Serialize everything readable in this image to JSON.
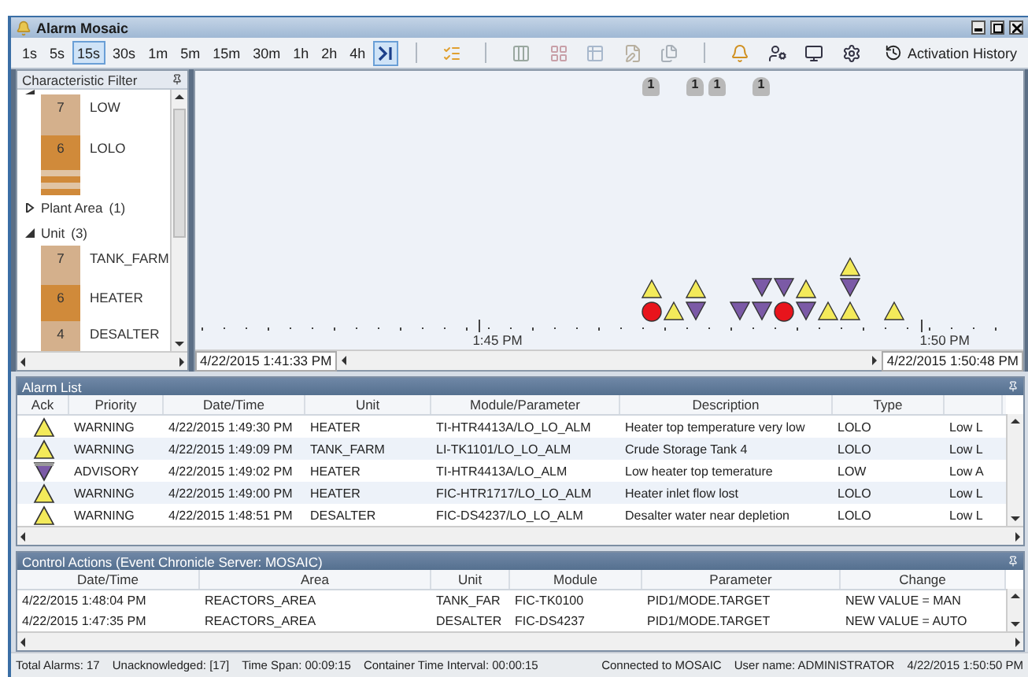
{
  "window": {
    "title": "Alarm Mosaic"
  },
  "toolbar": {
    "time_spans": [
      {
        "label": "1s",
        "selected": false
      },
      {
        "label": "5s",
        "selected": false
      },
      {
        "label": "15s",
        "selected": true
      },
      {
        "label": "30s",
        "selected": false
      },
      {
        "label": "1m",
        "selected": false
      },
      {
        "label": "5m",
        "selected": false
      },
      {
        "label": "15m",
        "selected": false
      },
      {
        "label": "30m",
        "selected": false
      },
      {
        "label": "1h",
        "selected": false
      },
      {
        "label": "2h",
        "selected": false
      },
      {
        "label": "4h",
        "selected": false
      }
    ],
    "live_mode": true,
    "history_button": "Activation History"
  },
  "filter": {
    "title": "Characteristic Filter",
    "groups": [
      {
        "expanded": true,
        "items": [
          {
            "count": "7",
            "label": "LOW",
            "color": "#d4b08c"
          },
          {
            "count": "6",
            "label": "LOLO",
            "color": "#d08a3a"
          },
          {
            "color": "#e0c4a4"
          },
          {
            "color": "#d08a3a"
          },
          {
            "color": "#e0c4a4"
          },
          {
            "color": "#d08a3a"
          }
        ]
      },
      {
        "label": "Plant Area",
        "count": "(1)",
        "expanded": false
      },
      {
        "label": "Unit",
        "count": "(3)",
        "expanded": true,
        "items": [
          {
            "count": "7",
            "label": "TANK_FARM",
            "color": "#d4b08c"
          },
          {
            "count": "6",
            "label": "HEATER",
            "color": "#d08a3a"
          },
          {
            "count": "4",
            "label": "DESALTER",
            "color": "#d4b08c"
          }
        ]
      }
    ]
  },
  "timeline": {
    "event_badges": [
      "1",
      "1",
      "1",
      "1"
    ],
    "axis_labels": [
      "1:45 PM",
      "1:50 PM"
    ],
    "start": "4/22/2015 1:41:33 PM",
    "end": "4/22/2015 1:50:48 PM"
  },
  "alarm_list": {
    "title": "Alarm List",
    "columns": [
      "Ack",
      "Priority",
      "Date/Time",
      "Unit",
      "Module/Parameter",
      "Description",
      "Type"
    ],
    "rows": [
      {
        "kind": "warning",
        "priority": "WARNING",
        "datetime": "4/22/2015 1:49:30 PM",
        "unit": "HEATER",
        "module": "TI-HTR4413A/LO_LO_ALM",
        "description": "Heater top temperature very low",
        "type": "LOLO",
        "column_8": "Low L"
      },
      {
        "kind": "warning",
        "priority": "WARNING",
        "datetime": "4/22/2015 1:49:09 PM",
        "unit": "TANK_FARM",
        "module": "LI-TK1101/LO_LO_ALM",
        "description": "Crude Storage Tank 4",
        "type": "LOLO",
        "column_8": "Low L"
      },
      {
        "kind": "advisory",
        "priority": "ADVISORY",
        "datetime": "4/22/2015 1:49:02 PM",
        "unit": "HEATER",
        "module": "TI-HTR4413A/LO_ALM",
        "description": "Low heater top temerature",
        "type": "LOW",
        "column_8": "Low A"
      },
      {
        "kind": "warning",
        "priority": "WARNING",
        "datetime": "4/22/2015 1:49:00 PM",
        "unit": "HEATER",
        "module": "FIC-HTR1717/LO_LO_ALM",
        "description": "Heater inlet flow lost",
        "type": "LOLO",
        "column_8": "Low L"
      },
      {
        "kind": "warning",
        "priority": "WARNING",
        "datetime": "4/22/2015 1:48:51 PM",
        "unit": "DESALTER",
        "module": "FIC-DS4237/LO_LO_ALM",
        "description": "Desalter water near depletion",
        "type": "LOLO",
        "column_8": "Low L"
      }
    ]
  },
  "control_actions": {
    "title": "Control Actions (Event Chronicle Server: MOSAIC)",
    "columns": [
      "Date/Time",
      "Area",
      "Unit",
      "Module",
      "Parameter",
      "Change"
    ],
    "rows": [
      [
        "4/22/2015 1:48:04 PM",
        "REACTORS_AREA",
        "TANK_FAR",
        "FIC-TK0100",
        "PID1/MODE.TARGET",
        "NEW VALUE = MAN"
      ],
      [
        "4/22/2015 1:47:35 PM",
        "REACTORS_AREA",
        "DESALTER",
        "FIC-DS4237",
        "PID1/MODE.TARGET",
        "NEW VALUE = AUTO"
      ]
    ]
  },
  "status_bar": {
    "left": [
      "Total Alarms: 17",
      "Unacknowledged: [17]",
      "Time Span: 00:09:15",
      "Container Time Interval: 00:00:15"
    ],
    "right": [
      "Connected to MOSAIC",
      "User name:  ADMINISTRATOR",
      "4/22/2015 1:50:50 PM"
    ]
  }
}
